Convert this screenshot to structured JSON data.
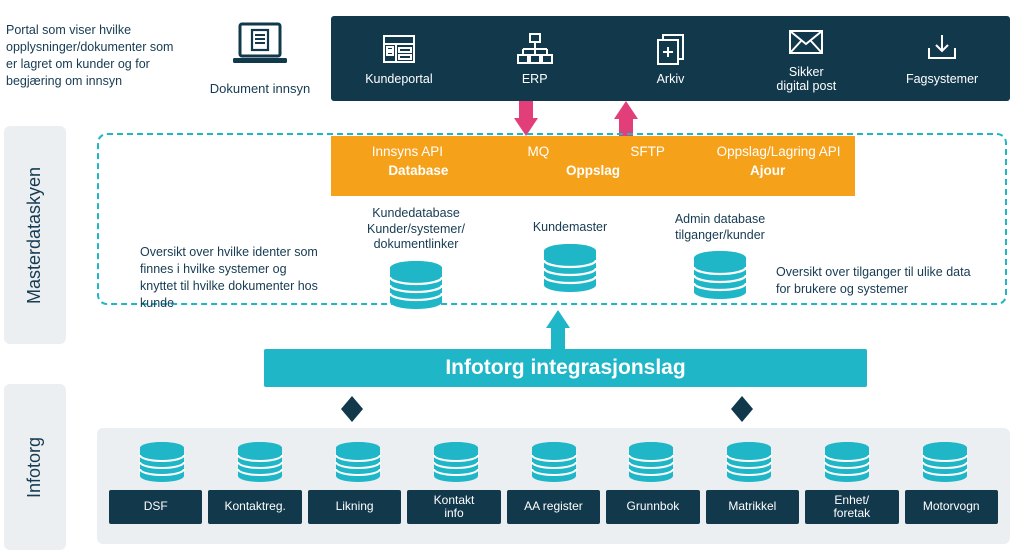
{
  "top_left_text": "Portal som viser hvilke opplysninger/dokumenter som er lagret om kunder og for begjæring om innsyn",
  "doc_innsyn_label": "Dokument innsyn",
  "lane": {
    "master": "Masterdataskyen",
    "infotorg": "Infotorg"
  },
  "topbar": [
    {
      "label": "Kundeportal",
      "icon": "app-window"
    },
    {
      "label": "ERP",
      "icon": "org-chart"
    },
    {
      "label": "Arkiv",
      "icon": "add-docs"
    },
    {
      "label": "Sikker\ndigital post",
      "icon": "envelope"
    },
    {
      "label": "Fagsystemer",
      "icon": "download-tray"
    }
  ],
  "orange": {
    "row1": [
      "Innsyns API",
      "MQ",
      "SFTP",
      "Oppslag/Lagring API"
    ],
    "row2": [
      "Database",
      "Oppslag",
      "Ajour"
    ]
  },
  "dashed_dbs": {
    "left_text": "Oversikt over hvilke identer som finnes i hvilke systemer og knyttet til hvilke dokumenter hos kunde",
    "right_text": "Oversikt over tilganger til ulike data for brukere og systemer",
    "items": [
      {
        "title": "Kundedatabase\nKunder/systemer/\ndokumentlinker"
      },
      {
        "title": "Kundemaster"
      },
      {
        "title": "Admin database\ntilganger/kunder"
      }
    ]
  },
  "integration_bar": "Infotorg integrasjonslag",
  "infotorg_sources": [
    "DSF",
    "Kontaktreg.",
    "Likning",
    "Kontakt\ninfo",
    "AA register",
    "Grunnbok",
    "Matrikkel",
    "Enhet/\nforetak",
    "Motorvogn"
  ],
  "colors": {
    "teal": "#1FB6C8",
    "orange": "#F6A11A",
    "darknavy": "#12384C",
    "pink": "#E23E7A",
    "gray": "#ECEFF1"
  }
}
